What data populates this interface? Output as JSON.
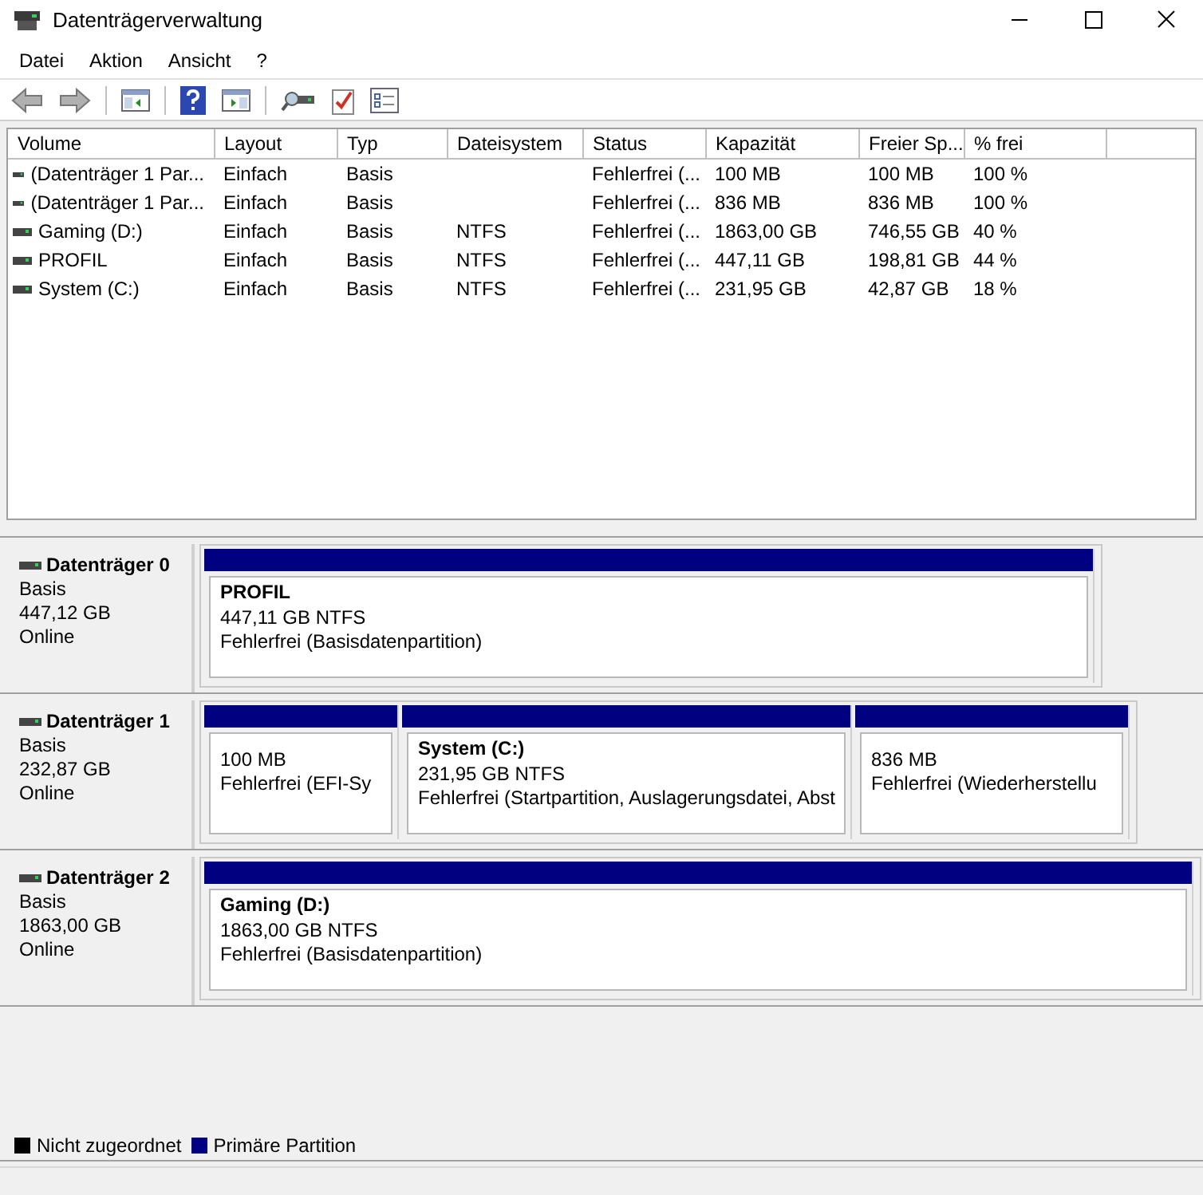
{
  "window": {
    "title": "Datenträgerverwaltung"
  },
  "menu": [
    "Datei",
    "Aktion",
    "Ansicht",
    "?"
  ],
  "toolbar": [
    {
      "kind": "back",
      "disabled": true
    },
    {
      "kind": "forward",
      "disabled": true
    },
    {
      "kind": "sep"
    },
    {
      "kind": "panel"
    },
    {
      "kind": "sep"
    },
    {
      "kind": "help"
    },
    {
      "kind": "panel2"
    },
    {
      "kind": "sep"
    },
    {
      "kind": "disk"
    },
    {
      "kind": "check"
    },
    {
      "kind": "list"
    }
  ],
  "table": {
    "columns": [
      "Volume",
      "Layout",
      "Typ",
      "Dateisystem",
      "Status",
      "Kapazität",
      "Freier Sp...",
      "% frei"
    ],
    "rows": [
      [
        "(Datenträger 1 Par...",
        "Einfach",
        "Basis",
        "",
        "Fehlerfrei (...",
        "100 MB",
        "100 MB",
        "100 %"
      ],
      [
        "(Datenträger 1 Par...",
        "Einfach",
        "Basis",
        "",
        "Fehlerfrei (...",
        "836 MB",
        "836 MB",
        "100 %"
      ],
      [
        "Gaming (D:)",
        "Einfach",
        "Basis",
        "NTFS",
        "Fehlerfrei (...",
        "1863,00 GB",
        "746,55 GB",
        "40 %"
      ],
      [
        "PROFIL",
        "Einfach",
        "Basis",
        "NTFS",
        "Fehlerfrei (...",
        "447,11 GB",
        "198,81 GB",
        "44 %"
      ],
      [
        "System (C:)",
        "Einfach",
        "Basis",
        "NTFS",
        "Fehlerfrei (...",
        "231,95 GB",
        "42,87 GB",
        "18 %"
      ]
    ]
  },
  "disks": [
    {
      "name": "Datenträger 0",
      "type": "Basis",
      "size": "447,12 GB",
      "state": "Online",
      "partitions": [
        {
          "label": "PROFIL",
          "size": "447,11 GB NTFS",
          "status": "Fehlerfrei (Basisdatenpartition)"
        }
      ]
    },
    {
      "name": "Datenträger 1",
      "type": "Basis",
      "size": "232,87 GB",
      "state": "Online",
      "partitions": [
        {
          "size": "100 MB",
          "status": "Fehlerfrei (EFI-Sy"
        },
        {
          "label": "System  (C:)",
          "size": "231,95 GB NTFS",
          "status": "Fehlerfrei (Startpartition, Auslagerungsdatei, Abst"
        },
        {
          "size": "836 MB",
          "status": "Fehlerfrei (Wiederherstellu"
        }
      ]
    },
    {
      "name": "Datenträger 2",
      "type": "Basis",
      "size": "1863,00 GB",
      "state": "Online",
      "partitions": [
        {
          "label": "Gaming  (D:)",
          "size": "1863,00 GB NTFS",
          "status": "Fehlerfrei (Basisdatenpartition)"
        }
      ]
    }
  ],
  "legend": [
    {
      "label": "Nicht zugeordnet",
      "color": "#000000"
    },
    {
      "label": "Primäre Partition",
      "color": "#000080"
    }
  ]
}
